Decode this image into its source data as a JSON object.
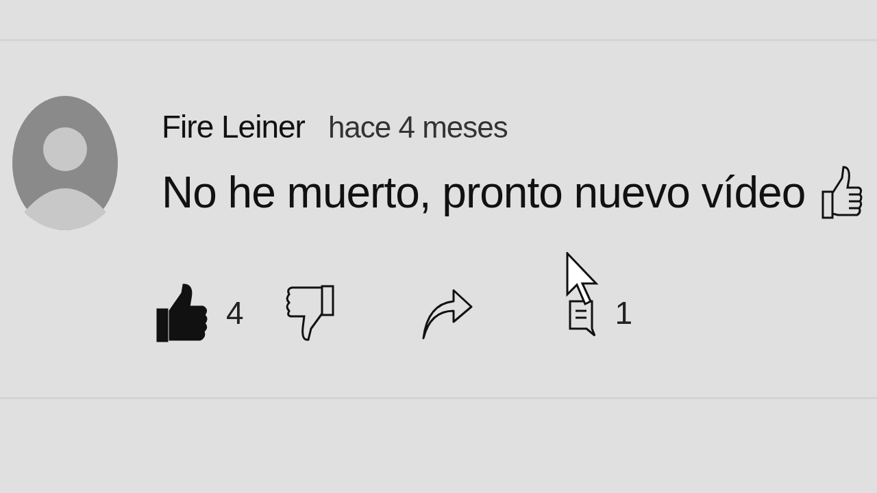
{
  "comment": {
    "author": "Fire Leiner",
    "time": "hace 4 meses",
    "text": "No he muerto, pronto nuevo vídeo",
    "like": {
      "selected": true,
      "count": "4"
    },
    "dislike": {
      "selected": false
    },
    "replies": {
      "count": "1"
    }
  }
}
